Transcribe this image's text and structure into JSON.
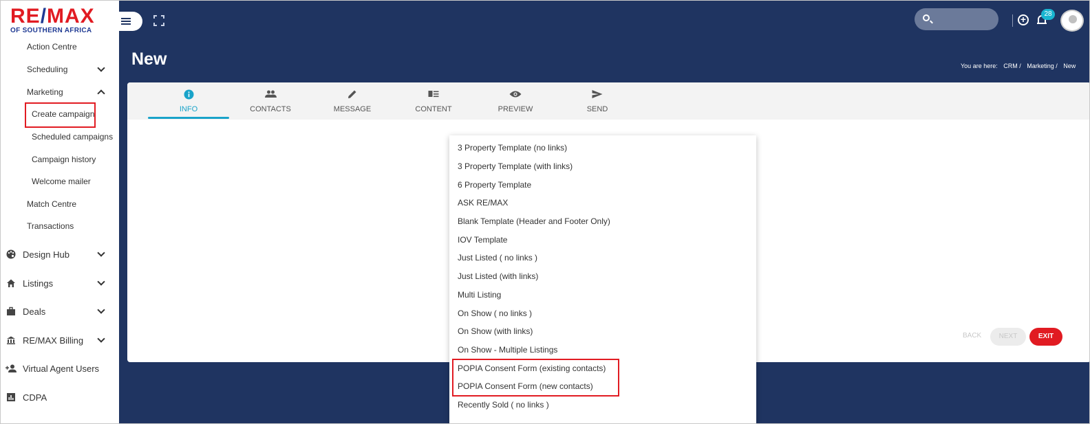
{
  "brand": {
    "logo_main": "RE/MAX",
    "logo_sub": "OF SOUTHERN AFRICA"
  },
  "sidebar": {
    "sub_items": [
      {
        "label": "Action Centre"
      },
      {
        "label": "Scheduling"
      },
      {
        "label": "Marketing"
      },
      {
        "label": "Create campaign"
      },
      {
        "label": "Scheduled campaigns"
      },
      {
        "label": "Campaign history"
      },
      {
        "label": "Welcome mailer"
      },
      {
        "label": "Match Centre"
      },
      {
        "label": "Transactions"
      }
    ],
    "main_items": [
      {
        "label": "Design Hub",
        "icon": "palette-icon"
      },
      {
        "label": "Listings",
        "icon": "home-icon"
      },
      {
        "label": "Deals",
        "icon": "briefcase-icon"
      },
      {
        "label": "RE/MAX Billing",
        "icon": "bank-icon"
      },
      {
        "label": "Virtual Agent Users",
        "icon": "add-user-icon"
      },
      {
        "label": "CDPA",
        "icon": "chart-icon"
      }
    ]
  },
  "header": {
    "notification_count": "28",
    "page_title": "New",
    "breadcrumb": {
      "prefix": "You are here:",
      "items": [
        "CRM /",
        "Marketing /",
        "New"
      ]
    }
  },
  "tabs": [
    {
      "label": "INFO",
      "icon": "info-icon",
      "active": true
    },
    {
      "label": "CONTACTS",
      "icon": "people-icon"
    },
    {
      "label": "MESSAGE",
      "icon": "pencil-icon"
    },
    {
      "label": "CONTENT",
      "icon": "content-icon"
    },
    {
      "label": "PREVIEW",
      "icon": "eye-icon"
    },
    {
      "label": "SEND",
      "icon": "send-icon"
    }
  ],
  "actions": {
    "back": "BACK",
    "next": "NEXT",
    "exit": "EXIT"
  },
  "template_options": [
    "3 Property Template (no links)",
    "3 Property Template (with links)",
    "6 Property Template",
    "ASK RE/MAX",
    "Blank Template (Header and Footer Only)",
    "IOV Template",
    "Just Listed ( no links )",
    "Just Listed (with links)",
    "Multi Listing",
    "On Show ( no links )",
    "On Show (with links)",
    "On Show - Multiple Listings",
    "POPIA Consent Form (existing contacts)",
    "POPIA Consent Form (new contacts)",
    "Recently Sold ( no links )"
  ],
  "colors": {
    "navy": "#1f3461",
    "accent": "#19a3c9",
    "brand_red": "#e11b22"
  }
}
